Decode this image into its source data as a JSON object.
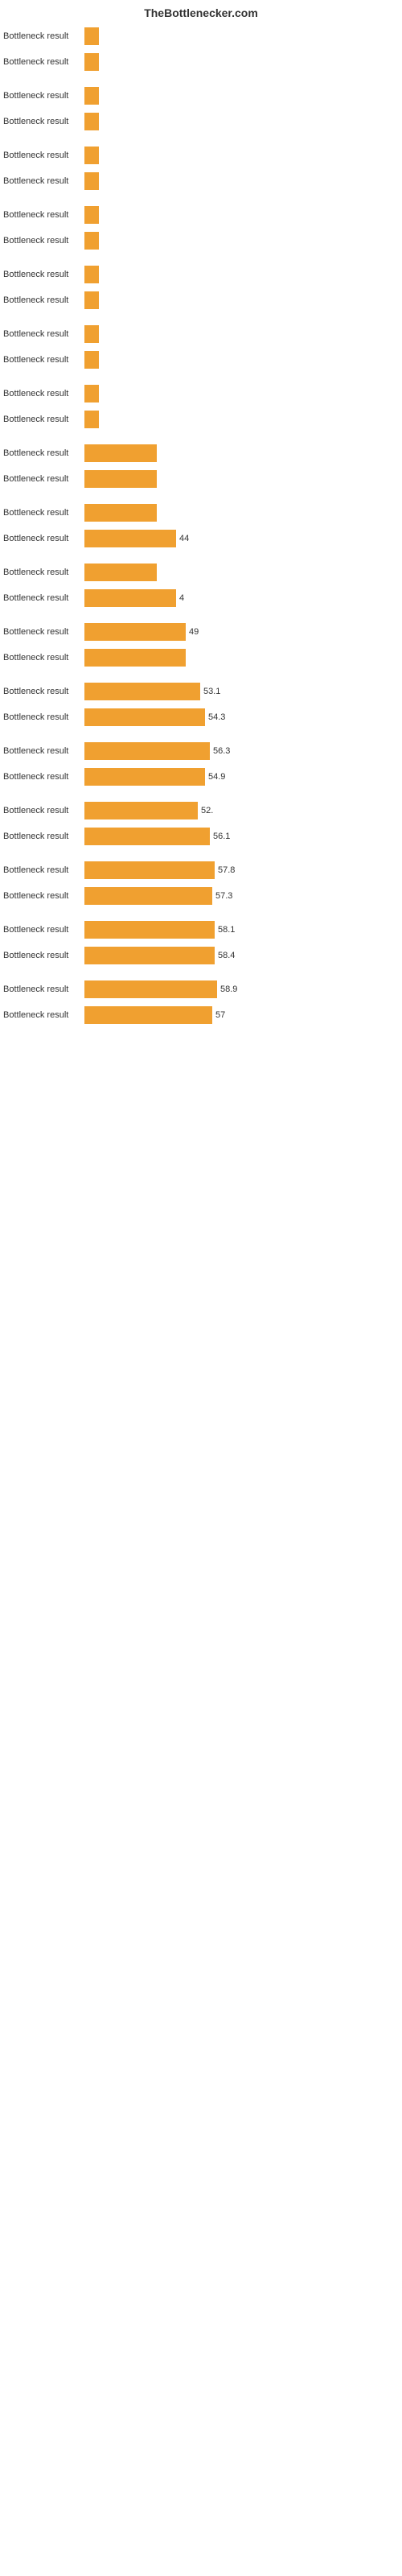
{
  "header": {
    "title": "TheBottlenecker.com"
  },
  "rows": [
    {
      "label": "Bottleneck result",
      "barWidth": 6,
      "value": ""
    },
    {
      "label": "Bottleneck result",
      "barWidth": 6,
      "value": ""
    },
    {
      "label": "Bottleneck result",
      "barWidth": 6,
      "value": ""
    },
    {
      "label": "Bottleneck result",
      "barWidth": 6,
      "value": ""
    },
    {
      "label": "Bottleneck result",
      "barWidth": 6,
      "value": ""
    },
    {
      "label": "Bottleneck result",
      "barWidth": 6,
      "value": ""
    },
    {
      "label": "Bottleneck result",
      "barWidth": 6,
      "value": ""
    },
    {
      "label": "Bottleneck result",
      "barWidth": 6,
      "value": ""
    },
    {
      "label": "Bottleneck result",
      "barWidth": 6,
      "value": ""
    },
    {
      "label": "Bottleneck result",
      "barWidth": 6,
      "value": ""
    },
    {
      "label": "Bottleneck result",
      "barWidth": 6,
      "value": ""
    },
    {
      "label": "Bottleneck result",
      "barWidth": 6,
      "value": ""
    },
    {
      "label": "Bottleneck result",
      "barWidth": 6,
      "value": ""
    },
    {
      "label": "Bottleneck result",
      "barWidth": 6,
      "value": ""
    },
    {
      "label": "Bottleneck result",
      "barWidth": 30,
      "value": ""
    },
    {
      "label": "Bottleneck result",
      "barWidth": 30,
      "value": ""
    },
    {
      "label": "Bottleneck result",
      "barWidth": 30,
      "value": ""
    },
    {
      "label": "Bottleneck result",
      "barWidth": 38,
      "value": "44"
    },
    {
      "label": "Bottleneck result",
      "barWidth": 30,
      "value": ""
    },
    {
      "label": "Bottleneck result",
      "barWidth": 38,
      "value": "4"
    },
    {
      "label": "Bottleneck result",
      "barWidth": 42,
      "value": "49"
    },
    {
      "label": "Bottleneck result",
      "barWidth": 42,
      "value": ""
    },
    {
      "label": "Bottleneck result",
      "barWidth": 48,
      "value": "53.1"
    },
    {
      "label": "Bottleneck result",
      "barWidth": 50,
      "value": "54.3"
    },
    {
      "label": "Bottleneck result",
      "barWidth": 52,
      "value": "56.3"
    },
    {
      "label": "Bottleneck result",
      "barWidth": 50,
      "value": "54.9"
    },
    {
      "label": "Bottleneck result",
      "barWidth": 47,
      "value": "52."
    },
    {
      "label": "Bottleneck result",
      "barWidth": 52,
      "value": "56.1"
    },
    {
      "label": "Bottleneck result",
      "barWidth": 54,
      "value": "57.8"
    },
    {
      "label": "Bottleneck result",
      "barWidth": 53,
      "value": "57.3"
    },
    {
      "label": "Bottleneck result",
      "barWidth": 54,
      "value": "58.1"
    },
    {
      "label": "Bottleneck result",
      "barWidth": 54,
      "value": "58.4"
    },
    {
      "label": "Bottleneck result",
      "barWidth": 55,
      "value": "58.9"
    },
    {
      "label": "Bottleneck result",
      "barWidth": 53,
      "value": "57"
    }
  ]
}
